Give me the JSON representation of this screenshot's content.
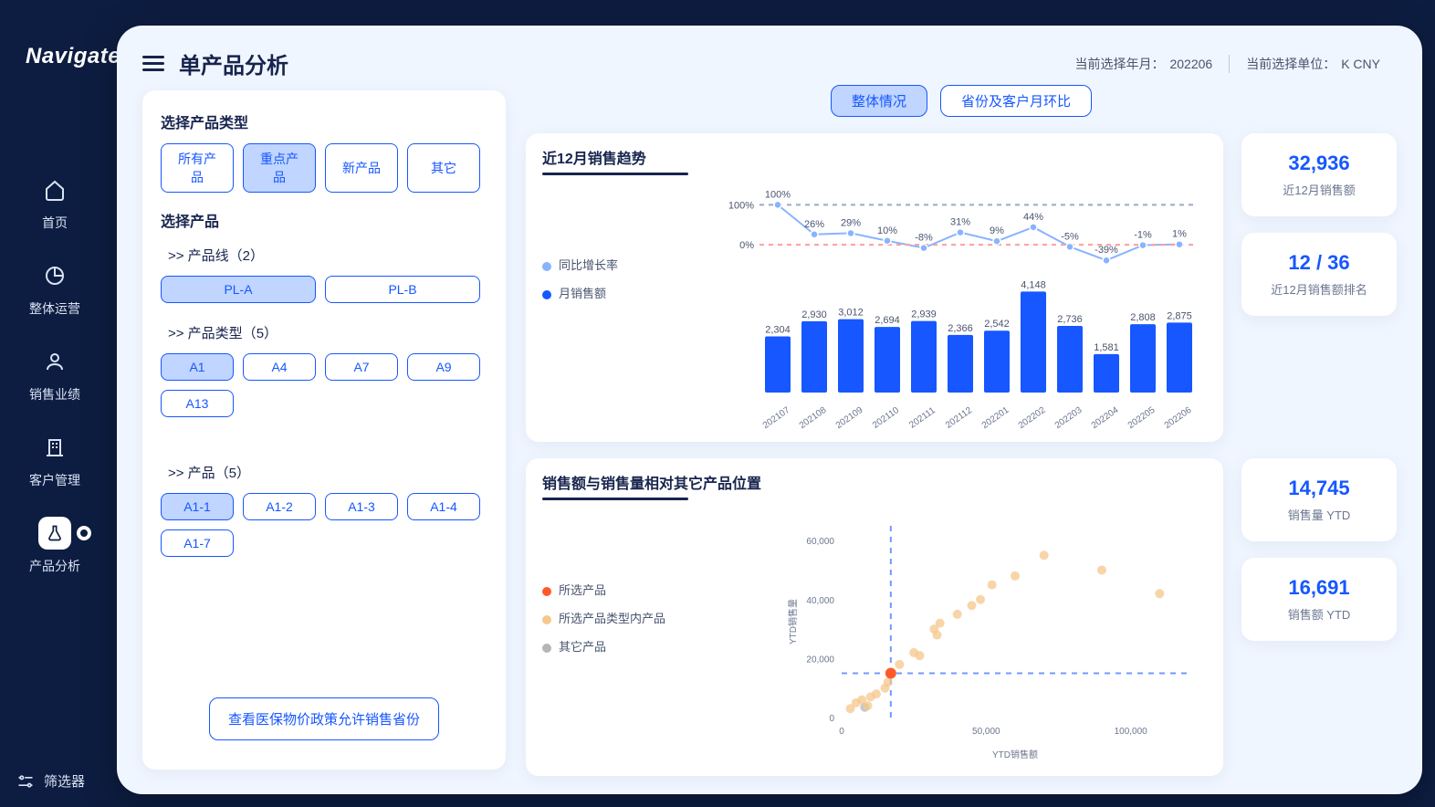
{
  "brand": "Navigate",
  "nav": {
    "items": [
      {
        "label": "首页",
        "icon": "home"
      },
      {
        "label": "整体运营",
        "icon": "pie"
      },
      {
        "label": "销售业绩",
        "icon": "person"
      },
      {
        "label": "客户管理",
        "icon": "building"
      },
      {
        "label": "产品分析",
        "icon": "flask"
      }
    ],
    "filter": "筛选器"
  },
  "header": {
    "title": "单产品分析",
    "ym_label": "当前选择年月：",
    "ym_value": "202206",
    "unit_label": "当前选择单位：",
    "unit_value": "K CNY"
  },
  "left": {
    "type_title": "选择产品类型",
    "types": [
      "所有产品",
      "重点产品",
      "新产品",
      "其它"
    ],
    "type_selected": 1,
    "product_title": "选择产品",
    "line_label": ">> 产品线（2）",
    "lines": [
      "PL-A",
      "PL-B"
    ],
    "line_selected": 0,
    "ptype_label": ">> 产品类型（5）",
    "ptypes": [
      "A1",
      "A4",
      "A7",
      "A9",
      "A13"
    ],
    "ptype_selected": 0,
    "prod_label": ">> 产品（5）",
    "prods": [
      "A1-1",
      "A1-2",
      "A1-3",
      "A1-7",
      "A1-4"
    ],
    "prod_selected": 0,
    "policy": "查看医保物价政策允许销售省份"
  },
  "tabs": {
    "items": [
      "整体情况",
      "省份及客户月环比"
    ],
    "selected": 0
  },
  "kpi": [
    {
      "val": "32,936",
      "lbl": "近12月销售额"
    },
    {
      "val": "12 / 36",
      "lbl": "近12月销售额排名"
    },
    {
      "val": "14,745",
      "lbl": "销售量 YTD"
    },
    {
      "val": "16,691",
      "lbl": "销售额 YTD"
    }
  ],
  "chart1": {
    "title": "近12月销售趋势",
    "legend": [
      "同比增长率",
      "月销售额"
    ]
  },
  "chart2": {
    "title": "销售额与销售量相对其它产品位置",
    "legend": [
      "所选产品",
      "所选产品类型内产品",
      "其它产品"
    ],
    "xlabel": "YTD销售额",
    "ylabel": "YTD销售量",
    "xticks": [
      "0",
      "50,000",
      "100,000"
    ],
    "yticks": [
      "0",
      "20,000",
      "40,000",
      "60,000"
    ]
  },
  "chart_data": [
    {
      "type": "line_bar",
      "categories": [
        "202107",
        "202108",
        "202109",
        "202110",
        "202111",
        "202112",
        "202201",
        "202202",
        "202203",
        "202204",
        "202205",
        "202206"
      ],
      "series": [
        {
          "name": "月销售额",
          "type": "bar",
          "values": [
            2304,
            2930,
            3012,
            2694,
            2939,
            2366,
            2542,
            4148,
            2736,
            1581,
            2808,
            2875
          ]
        },
        {
          "name": "同比增长率",
          "type": "line",
          "values": [
            100,
            26,
            29,
            10,
            -8,
            31,
            9,
            44,
            -5,
            -39,
            -1,
            1
          ],
          "unit": "%",
          "ref_lines": [
            0,
            100
          ]
        }
      ]
    },
    {
      "type": "scatter",
      "xlabel": "YTD销售额",
      "ylabel": "YTD销售量",
      "xlim": [
        0,
        120000
      ],
      "ylim": [
        0,
        65000
      ],
      "xticks": [
        0,
        50000,
        100000
      ],
      "yticks": [
        0,
        20000,
        40000,
        60000
      ],
      "crosshair": {
        "x": 17000,
        "y": 15000
      },
      "series": [
        {
          "name": "所选产品",
          "color": "#ff5a2a",
          "points": [
            [
              17000,
              15000
            ]
          ]
        },
        {
          "name": "所选产品类型内产品",
          "color": "#f6c78c",
          "points": [
            [
              3000,
              3000
            ],
            [
              5000,
              5000
            ],
            [
              7000,
              6000
            ],
            [
              9000,
              4000
            ],
            [
              10000,
              7000
            ],
            [
              12000,
              8000
            ],
            [
              15000,
              10000
            ],
            [
              16000,
              12000
            ],
            [
              20000,
              18000
            ],
            [
              25000,
              22000
            ],
            [
              27000,
              21000
            ],
            [
              32000,
              30000
            ],
            [
              33000,
              28000
            ],
            [
              34000,
              32000
            ],
            [
              40000,
              35000
            ],
            [
              45000,
              38000
            ],
            [
              48000,
              40000
            ],
            [
              52000,
              45000
            ],
            [
              60000,
              48000
            ],
            [
              70000,
              55000
            ],
            [
              90000,
              50000
            ],
            [
              110000,
              42000
            ]
          ]
        },
        {
          "name": "其它产品",
          "color": "#b6b6b6",
          "points": [
            [
              8000,
              3500
            ]
          ]
        }
      ]
    }
  ]
}
